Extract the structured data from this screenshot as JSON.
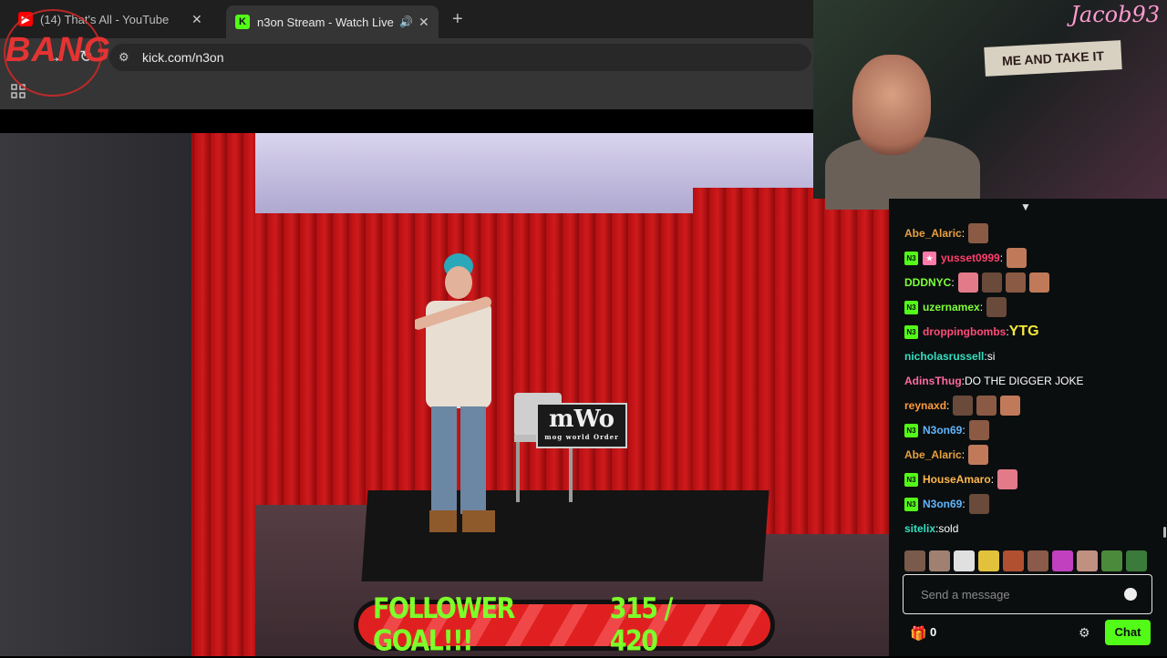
{
  "browser": {
    "tabs": [
      {
        "title": "(14) That's All - YouTube",
        "favicon": "youtube-icon",
        "active": false
      },
      {
        "title": "n3on Stream - Watch Live o",
        "favicon": "kick-icon",
        "active": true
      }
    ],
    "url": "kick.com/n3on",
    "overlay_logo": "BANG"
  },
  "stream": {
    "stage_logo": "mWo",
    "stage_logo_sub": "mog world Order",
    "goal_label": "FOLLOWER GOAL!!!",
    "goal_count": "315 / 420",
    "goal_current": 315,
    "goal_target": 420,
    "webcam_name": "Jacob93",
    "webcam_sign": "ME AND TAKE IT"
  },
  "chat": {
    "messages": [
      {
        "user": "Abe_Alaric",
        "text": "",
        "color": "#e8a040",
        "badges": [],
        "emotes": 1
      },
      {
        "user": "yusset0999",
        "text": "",
        "color": "#ff3f6e",
        "badges": [
          "N3",
          "gift"
        ],
        "emotes": 1
      },
      {
        "user": "DDDNYC",
        "text": "",
        "color": "#7dff3a",
        "badges": [],
        "emotes": 4
      },
      {
        "user": "uzernamex",
        "text": "",
        "color": "#7dff3a",
        "badges": [
          "N3"
        ],
        "emotes": 1
      },
      {
        "user": "droppingbombs",
        "text": "YTG",
        "color": "#ff4c7a",
        "badges": [
          "N3"
        ],
        "emotes": 0
      },
      {
        "user": "nicholasrussell",
        "text": "si",
        "color": "#33e0c0",
        "badges": [],
        "emotes": 0
      },
      {
        "user": "AdinsThug",
        "text": "DO THE DIGGER JOKE",
        "color": "#ff6aa0",
        "badges": [],
        "emotes": 0
      },
      {
        "user": "reynaxd",
        "text": "",
        "color": "#ff9b3a",
        "badges": [],
        "emotes": 3
      },
      {
        "user": "N3on69",
        "text": "",
        "color": "#5fb6ff",
        "badges": [
          "N3"
        ],
        "emotes": 1
      },
      {
        "user": "Abe_Alaric",
        "text": "",
        "color": "#e8a040",
        "badges": [],
        "emotes": 1
      },
      {
        "user": "HouseAmaro",
        "text": "",
        "color": "#ffb74d",
        "badges": [
          "N3"
        ],
        "emotes": 1
      },
      {
        "user": "N3on69",
        "text": "",
        "color": "#5fb6ff",
        "badges": [
          "N3"
        ],
        "emotes": 1
      },
      {
        "user": "sitelix",
        "text": "sold",
        "color": "#33e0c0",
        "badges": [],
        "emotes": 0
      }
    ],
    "input_placeholder": "Send a message",
    "gift_count": "0",
    "send_label": "Chat",
    "accent": "#53fc18"
  }
}
